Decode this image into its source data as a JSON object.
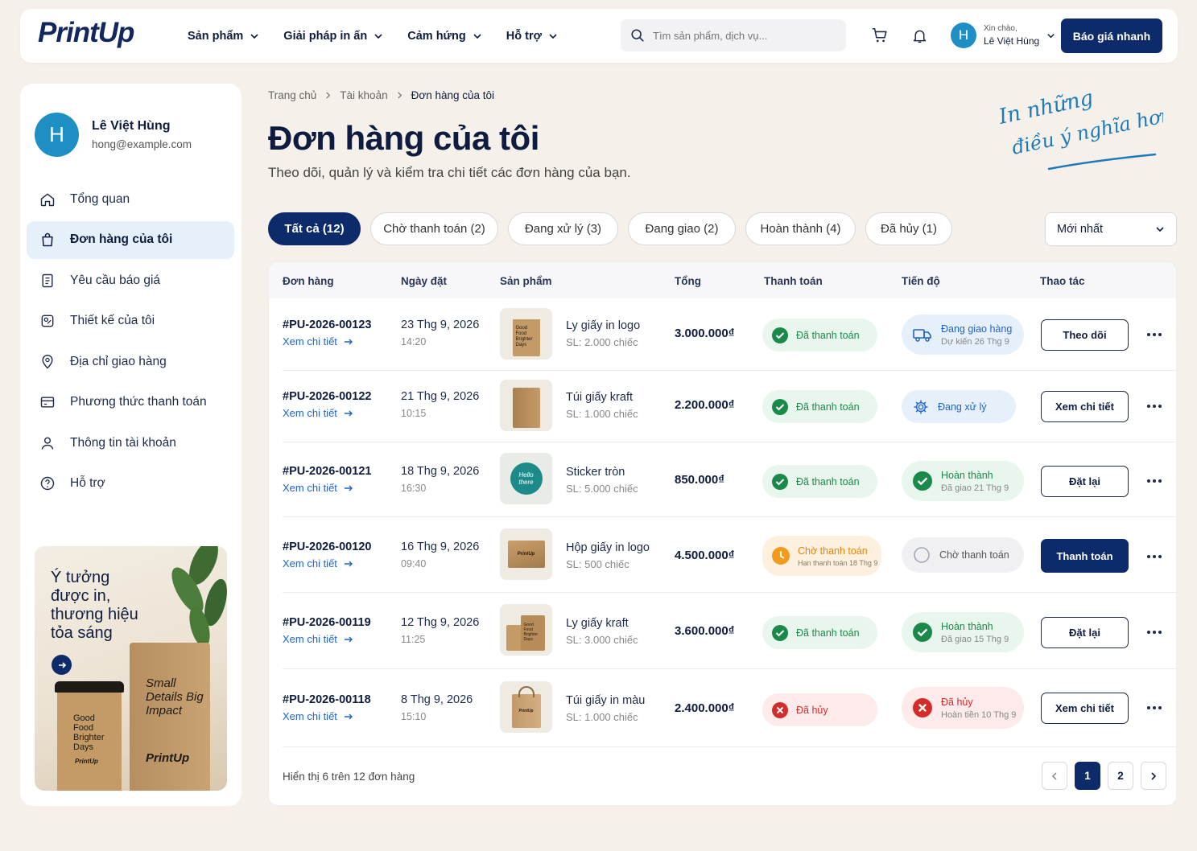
{
  "header": {
    "logo": "PrintUp",
    "nav": [
      {
        "label": "Sản phẩm"
      },
      {
        "label": "Giải pháp in ấn"
      },
      {
        "label": "Cảm hứng"
      },
      {
        "label": "Hỗ trợ"
      }
    ],
    "search_placeholder": "Tìm sản phẩm, dịch vụ...",
    "greeting": "Xin chào,",
    "user_name": "Lê Việt Hùng",
    "avatar_letter": "H",
    "quote_button": "Báo giá nhanh"
  },
  "sidebar": {
    "avatar_letter": "H",
    "name": "Lê Việt Hùng",
    "email": "hong@example.com",
    "items": [
      {
        "label": "Tổng quan",
        "icon": "home-icon"
      },
      {
        "label": "Đơn hàng của tôi",
        "icon": "shopping-bag-icon"
      },
      {
        "label": "Yêu cầu báo giá",
        "icon": "document-icon"
      },
      {
        "label": "Thiết kế của tôi",
        "icon": "design-icon"
      },
      {
        "label": "Địa chỉ giao hàng",
        "icon": "location-icon"
      },
      {
        "label": "Phương thức thanh toán",
        "icon": "card-icon"
      },
      {
        "label": "Thông tin tài khoản",
        "icon": "user-icon"
      },
      {
        "label": "Hỗ trợ",
        "icon": "help-icon"
      }
    ],
    "promo": {
      "text": "Ý tưởng được in, thương hiệu tỏa sáng",
      "cup_text": "Good Food Brighter Days",
      "cup_brand": "PrintUp",
      "bag_text": "Small Details Big Impact",
      "bag_brand": "PrintUp"
    }
  },
  "breadcrumb": [
    "Trang chủ",
    "Tài khoản",
    "Đơn hàng của tôi"
  ],
  "page": {
    "title": "Đơn hàng của tôi",
    "subtitle": "Theo dõi, quản lý và kiểm tra chi tiết các đơn hàng của bạn.",
    "slogan_line1": "In những",
    "slogan_line2": "điều ý nghĩa hơn"
  },
  "tabs": [
    "Tất cả (12)",
    "Chờ thanh toán (2)",
    "Đang xử lý (3)",
    "Đang giao (2)",
    "Hoàn thành (4)",
    "Đã hủy (1)"
  ],
  "sort": "Mới nhất",
  "table": {
    "headers": [
      "Đơn hàng",
      "Ngày đặt",
      "Sản phẩm",
      "Tổng",
      "Thanh toán",
      "Tiến độ",
      "Thao tác"
    ],
    "link_label": "Xem chi tiết",
    "rows": [
      {
        "id": "#PU-2026-00123",
        "date": "23 Thg 9, 2026",
        "time": "14:20",
        "product": "Ly giấy in logo",
        "qty": "SL: 2.000 chiếc",
        "total": "3.000.000₫",
        "pay": "Đã thanh toán",
        "pay_sub": "",
        "status": "Đang giao hàng",
        "status_sub": "Dự kiến 26 Thg 9",
        "action": "Theo dõi"
      },
      {
        "id": "#PU-2026-00122",
        "date": "21 Thg 9, 2026",
        "time": "10:15",
        "product": "Túi giấy kraft",
        "qty": "SL: 1.000 chiếc",
        "total": "2.200.000₫",
        "pay": "Đã thanh toán",
        "pay_sub": "",
        "status": "Đang xử lý",
        "status_sub": "",
        "action": "Xem chi tiết"
      },
      {
        "id": "#PU-2026-00121",
        "date": "18 Thg 9, 2026",
        "time": "16:30",
        "product": "Sticker tròn",
        "qty": "SL: 5.000 chiếc",
        "total": "850.000₫",
        "pay": "Đã thanh toán",
        "pay_sub": "",
        "status": "Hoàn thành",
        "status_sub": "Đã giao 21 Thg 9",
        "action": "Đặt lại"
      },
      {
        "id": "#PU-2026-00120",
        "date": "16 Thg 9, 2026",
        "time": "09:40",
        "product": "Hộp giấy in logo",
        "qty": "SL: 500 chiếc",
        "total": "4.500.000₫",
        "pay": "Chờ thanh toán",
        "pay_sub": "Hạn thanh toán 18 Thg 9",
        "status": "Chờ thanh toán",
        "status_sub": "",
        "action": "Thanh toán"
      },
      {
        "id": "#PU-2026-00119",
        "date": "12 Thg 9, 2026",
        "time": "11:25",
        "product": "Ly giấy kraft",
        "qty": "SL: 3.000 chiếc",
        "total": "3.600.000₫",
        "pay": "Đã thanh toán",
        "pay_sub": "",
        "status": "Hoàn thành",
        "status_sub": "Đã giao 15 Thg 9",
        "action": "Đặt lại"
      },
      {
        "id": "#PU-2026-00118",
        "date": "8 Thg 9, 2026",
        "time": "15:10",
        "product": "Túi giấy in màu",
        "qty": "SL: 1.000 chiếc",
        "total": "2.400.000₫",
        "pay": "Đã hủy",
        "pay_sub": "",
        "status": "Đã hủy",
        "status_sub": "Hoàn tiền 10 Thg 9",
        "action": "Xem chi tiết"
      }
    ],
    "thumb_texts": [
      "Good Food Brighter Days",
      "",
      "Hello there",
      "PrintUp",
      "Good Food Brighter Days",
      "PrintUp"
    ],
    "footer": "Hiển thị 6 trên 12 đơn hàng",
    "pages": [
      "1",
      "2"
    ]
  },
  "colors": {
    "primary": "#0d2a6b",
    "accent": "#1e8fc4",
    "success": "#1a8a4a",
    "warning": "#e8840c",
    "danger": "#d42b2b",
    "background": "#f5f1ea"
  }
}
